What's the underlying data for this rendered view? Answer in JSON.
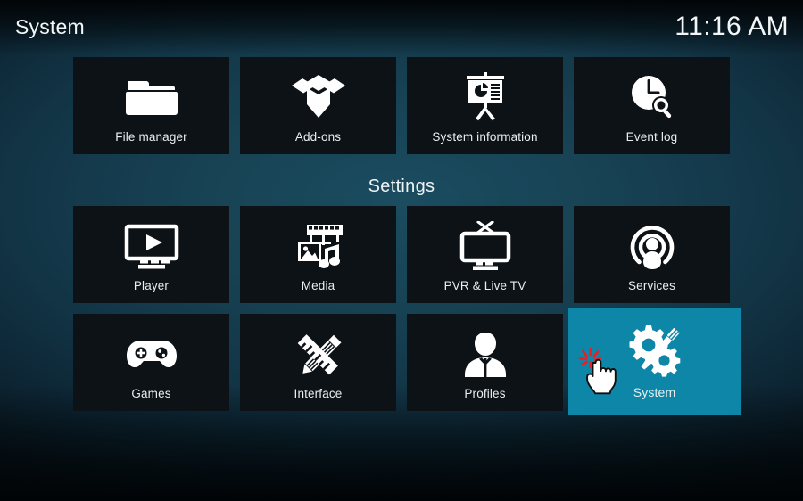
{
  "header": {
    "title": "System",
    "clock": "11:16 AM"
  },
  "section": {
    "settings_heading": "Settings"
  },
  "colors": {
    "highlight": "#0e86a8",
    "tile_background": "#0d1217",
    "text": "#e9eef1",
    "cursor_click_burst": "#ee1c24"
  },
  "rows": {
    "top": [
      {
        "label": "File manager",
        "icon": "folder-icon",
        "selected": false
      },
      {
        "label": "Add-ons",
        "icon": "open-box-icon",
        "selected": false
      },
      {
        "label": "System information",
        "icon": "presentation-chart-icon",
        "selected": false
      },
      {
        "label": "Event log",
        "icon": "clock-search-icon",
        "selected": false
      }
    ],
    "middle": [
      {
        "label": "Player",
        "icon": "monitor-play-icon",
        "selected": false
      },
      {
        "label": "Media",
        "icon": "film-photo-music-icon",
        "selected": false
      },
      {
        "label": "PVR & Live TV",
        "icon": "television-antenna-icon",
        "selected": false
      },
      {
        "label": "Services",
        "icon": "broadcast-person-icon",
        "selected": false
      }
    ],
    "bottom": [
      {
        "label": "Games",
        "icon": "gamepad-icon",
        "selected": false
      },
      {
        "label": "Interface",
        "icon": "pencil-ruler-icon",
        "selected": false
      },
      {
        "label": "Profiles",
        "icon": "user-silhouette-icon",
        "selected": false
      },
      {
        "label": "System",
        "icon": "gears-screwdriver-icon",
        "selected": true
      }
    ]
  },
  "cursor": {
    "name": "hand-pointer-cursor",
    "state": "clicking"
  }
}
